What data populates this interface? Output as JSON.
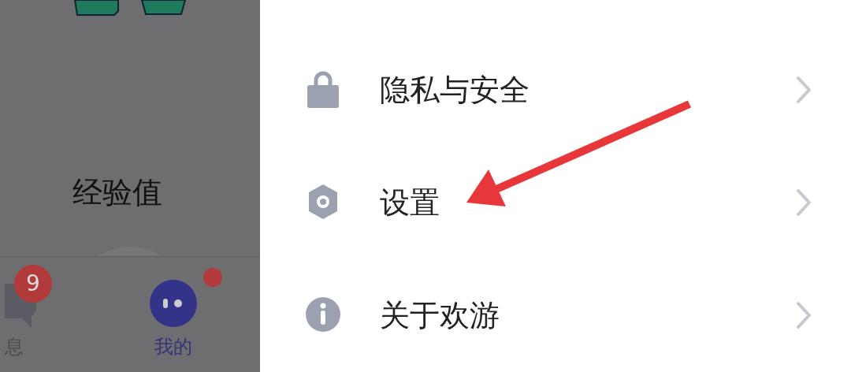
{
  "background_page": {
    "experience_label": "经验值",
    "tab_bar": [
      {
        "label": "息",
        "kind": "messages",
        "badge": "9",
        "selected": false,
        "dot": false
      },
      {
        "label": "我的",
        "kind": "profile",
        "selected": true,
        "dot": true
      }
    ]
  },
  "menu": {
    "items": [
      {
        "label": "隐私与安全",
        "kind": "lock"
      },
      {
        "label": "设置",
        "kind": "settings"
      },
      {
        "label": "关于欢游",
        "kind": "info"
      }
    ]
  },
  "annotation": {
    "kind": "arrow",
    "color": "#e8373a"
  }
}
